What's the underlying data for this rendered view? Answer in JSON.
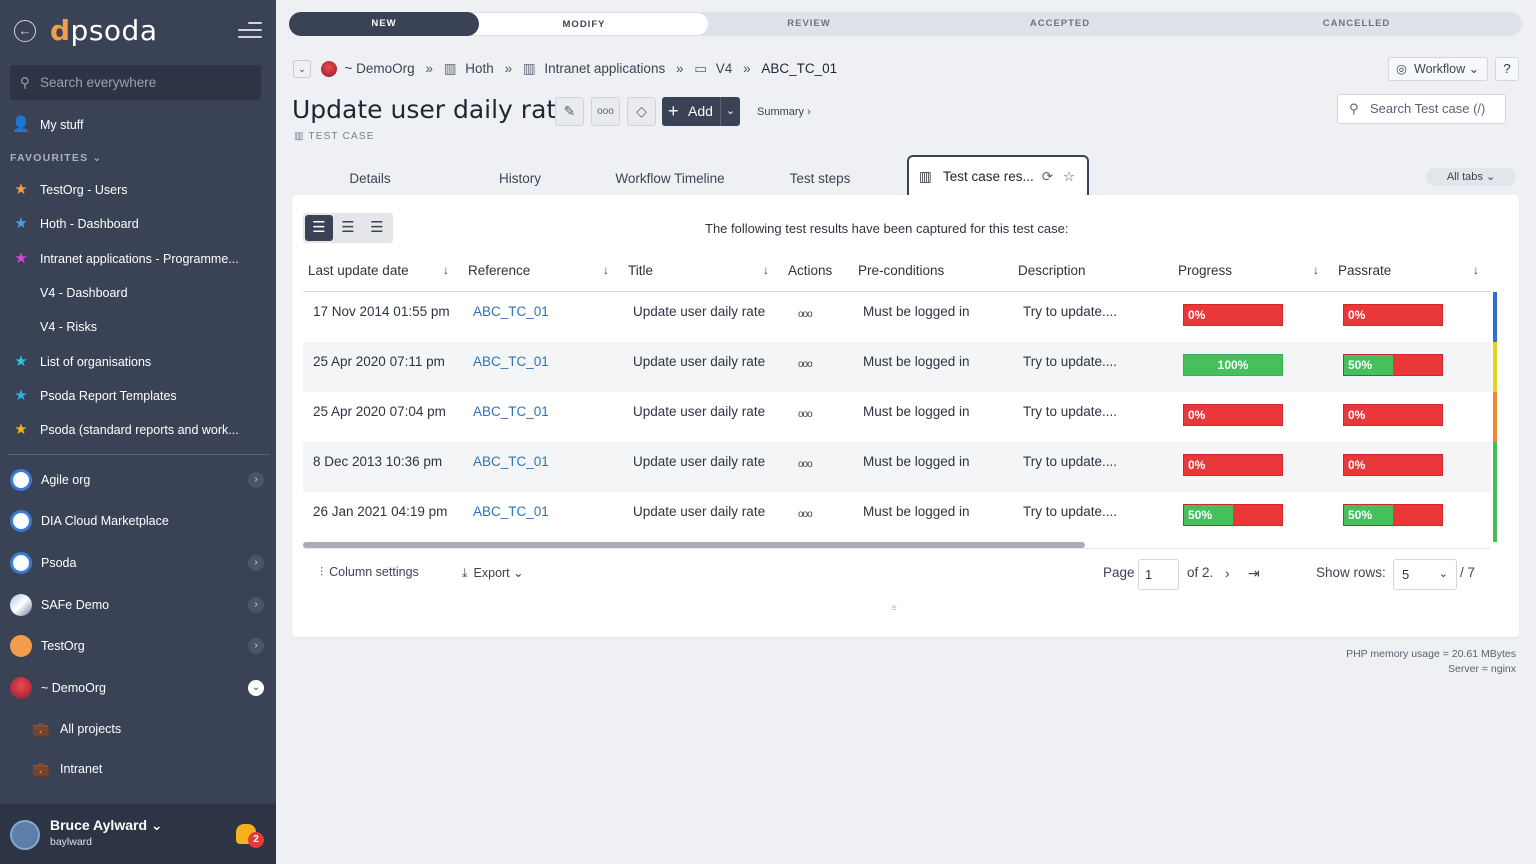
{
  "app": {
    "logo_text": "psoda"
  },
  "sidebar": {
    "search_placeholder": "Search everywhere",
    "my_stuff": "My stuff",
    "favourites_label": "FAVOURITES ⌄",
    "favourites": [
      {
        "label": "TestOrg - Users",
        "color": "#f39c4a"
      },
      {
        "label": "Hoth - Dashboard",
        "color": "#4d9de0"
      },
      {
        "label": "Intranet applications - Programme...",
        "color": "#d04bd8"
      },
      {
        "label": "V4 - Dashboard",
        "color": "#3a4256"
      },
      {
        "label": "V4 - Risks",
        "color": "#3a4256"
      },
      {
        "label": "List of organisations",
        "color": "#34c3d6"
      },
      {
        "label": "Psoda Report Templates",
        "color": "#34aee6"
      },
      {
        "label": "Psoda (standard reports and work...",
        "color": "#f5b21a"
      }
    ],
    "orgs": [
      {
        "label": "Agile org"
      },
      {
        "label": "DIA Cloud Marketplace"
      },
      {
        "label": "Psoda"
      },
      {
        "label": "SAFe Demo"
      },
      {
        "label": "TestOrg"
      },
      {
        "label": "~ DemoOrg"
      }
    ],
    "sub_items": [
      {
        "label": "All projects"
      },
      {
        "label": "Intranet"
      }
    ],
    "user": {
      "name": "Bruce Aylward ⌄",
      "login": "baylward",
      "notifications": "2"
    }
  },
  "workflow": {
    "steps": [
      "NEW",
      "MODIFY",
      "REVIEW",
      "ACCEPTED",
      "CANCELLED"
    ],
    "button": "Workflow ⌄",
    "help": "?"
  },
  "breadcrumb": {
    "items": [
      "~ DemoOrg",
      "Hoth",
      "Intranet applications",
      "V4",
      "ABC_TC_01"
    ],
    "separator": "»"
  },
  "header": {
    "title": "Update user daily rate",
    "add_label": "Add",
    "summary": "Summary ›",
    "type": "TEST CASE",
    "search_placeholder": "Search Test case (/)"
  },
  "tabs": {
    "items": [
      "Details",
      "History",
      "Workflow Timeline",
      "Test steps"
    ],
    "active": "Test case res...",
    "all_tabs": "All tabs ⌄"
  },
  "panel": {
    "intro": "The following test results have been captured for this test case:",
    "columns": [
      "Last update date",
      "Reference",
      "Title",
      "Actions",
      "Pre-conditions",
      "Description",
      "Progress",
      "Passrate"
    ],
    "rows": [
      {
        "date": "17 Nov 2014 01:55 pm",
        "ref": "ABC_TC_01",
        "title": "Update user daily rate",
        "actions": "ooo",
        "pre": "Must be logged in",
        "desc": "Try to update....",
        "progress": 0,
        "progress_label": "0%",
        "passrate": 0,
        "passrate_label": "0%",
        "status_color": "#2f6fce"
      },
      {
        "date": "25 Apr 2020 07:11 pm",
        "ref": "ABC_TC_01",
        "title": "Update user daily rate",
        "actions": "ooo",
        "pre": "Must be logged in",
        "desc": "Try to update....",
        "progress": 100,
        "progress_label": "100%",
        "passrate": 50,
        "passrate_label": "50%",
        "status_color": "#e2d41a"
      },
      {
        "date": "25 Apr 2020 07:04 pm",
        "ref": "ABC_TC_01",
        "title": "Update user daily rate",
        "actions": "ooo",
        "pre": "Must be logged in",
        "desc": "Try to update....",
        "progress": 0,
        "progress_label": "0%",
        "passrate": 0,
        "passrate_label": "0%",
        "status_color": "#ef8a2f"
      },
      {
        "date": "8 Dec 2013 10:36 pm",
        "ref": "ABC_TC_01",
        "title": "Update user daily rate",
        "actions": "ooo",
        "pre": "Must be logged in",
        "desc": "Try to update....",
        "progress": 0,
        "progress_label": "0%",
        "passrate": 0,
        "passrate_label": "0%",
        "status_color": "#3fbf55"
      },
      {
        "date": "26 Jan 2021 04:19 pm",
        "ref": "ABC_TC_01",
        "title": "Update user daily rate",
        "actions": "ooo",
        "pre": "Must be logged in",
        "desc": "Try to update....",
        "progress": 50,
        "progress_label": "50%",
        "passrate": 50,
        "passrate_label": "50%",
        "status_color": "#3fbf55"
      }
    ],
    "footer": {
      "column_settings": "Column settings",
      "export": "Export ⌄",
      "page_label": "Page",
      "page_value": "1",
      "of_pages": "of 2.",
      "show_rows": "Show rows:",
      "rows_value": "5",
      "rows_total": "/ 7"
    }
  },
  "server": {
    "memory": "PHP memory usage = 20.61 MBytes",
    "server": "Server = nginx"
  }
}
